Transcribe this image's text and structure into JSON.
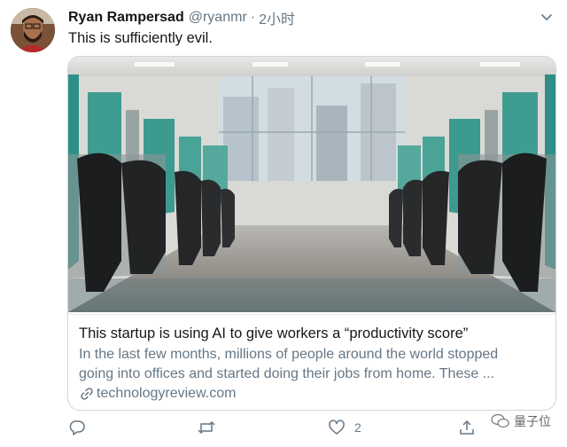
{
  "tweet": {
    "author_name": "Ryan Rampersad",
    "handle": "@ryanmr",
    "separator": "·",
    "time": "2小时",
    "text": "This is sufficiently evil."
  },
  "card": {
    "title": "This startup is using AI to give workers a “productivity score”",
    "description_line1": "In the last few months, millions of people around the world stopped",
    "description_line2": "going into offices and started doing their jobs from home. These ...",
    "domain": "technologyreview.com"
  },
  "actions": {
    "reply_count": "",
    "retweet_count": "",
    "like_count": "2"
  },
  "watermark": {
    "text": "量子位"
  },
  "colors": {
    "text": "#14171a",
    "secondary": "#657786",
    "border": "#ccd6dd"
  }
}
